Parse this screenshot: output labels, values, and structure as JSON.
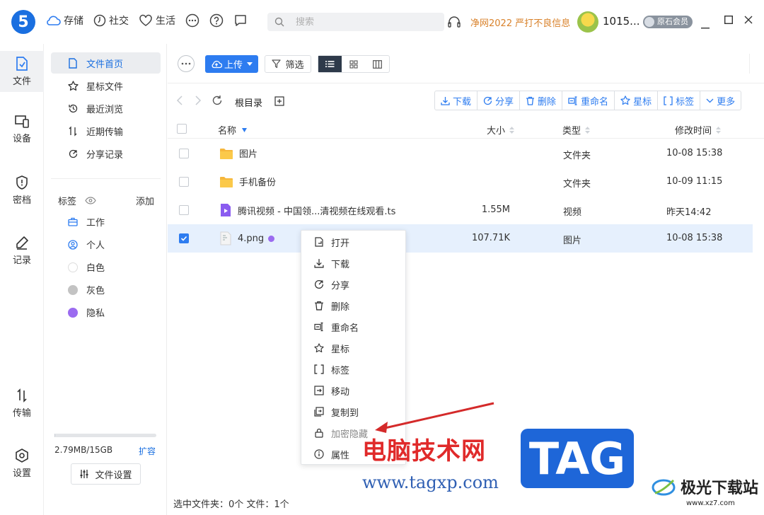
{
  "app": {
    "logo_text": "5",
    "nav": [
      {
        "label": "存储",
        "icon": "cloud-icon"
      },
      {
        "label": "社交",
        "icon": "clock-icon"
      },
      {
        "label": "生活",
        "icon": "heart-icon"
      }
    ],
    "search_placeholder": "搜索",
    "promo": "净网2022 严打不良信息",
    "username": "1015...",
    "member_badge": "原石会员"
  },
  "rail": [
    {
      "label": "文件",
      "icon": "file-icon",
      "active": true
    },
    {
      "label": "设备",
      "icon": "device-icon"
    },
    {
      "label": "密档",
      "icon": "shield-icon"
    },
    {
      "label": "记录",
      "icon": "pen-icon"
    },
    {
      "label": "传输",
      "icon": "transfer-icon"
    },
    {
      "label": "设置",
      "icon": "settings-icon"
    }
  ],
  "sidebar": {
    "items": [
      {
        "label": "文件首页",
        "icon": "document-icon",
        "active": true
      },
      {
        "label": "星标文件",
        "icon": "star-icon"
      },
      {
        "label": "最近浏览",
        "icon": "history-icon"
      },
      {
        "label": "近期传输",
        "icon": "transfer-icon"
      },
      {
        "label": "分享记录",
        "icon": "share-icon"
      }
    ],
    "tags_label": "标签",
    "tags_add": "添加",
    "tags": [
      {
        "label": "工作",
        "color": "#2d7cf0"
      },
      {
        "label": "个人",
        "color": "#2d7cf0"
      },
      {
        "label": "白色",
        "color": "#ffffff"
      },
      {
        "label": "灰色",
        "color": "#c3c3c3"
      },
      {
        "label": "隐私",
        "color": "#9b6bf0"
      }
    ],
    "storage_text": "2.79MB/15GB",
    "storage_used_fraction": 0.0002,
    "expand_label": "扩容",
    "file_settings_label": "文件设置"
  },
  "toolbar": {
    "upload_label": "上传",
    "filter_label": "筛选",
    "crumb": "根目录",
    "actions": [
      {
        "label": "下载",
        "icon": "download-icon"
      },
      {
        "label": "分享",
        "icon": "share-icon"
      },
      {
        "label": "删除",
        "icon": "trash-icon"
      },
      {
        "label": "重命名",
        "icon": "rename-icon"
      },
      {
        "label": "星标",
        "icon": "star-icon"
      },
      {
        "label": "标签",
        "icon": "tag-bracket-icon"
      },
      {
        "label": "更多",
        "icon": "chevron-down-icon"
      }
    ]
  },
  "table": {
    "headers": {
      "name": "名称",
      "size": "大小",
      "type": "类型",
      "mtime": "修改时间"
    },
    "rows": [
      {
        "name": "图片",
        "size": "",
        "type": "文件夹",
        "mtime": "10-08 15:38",
        "kind": "folder"
      },
      {
        "name": "手机备份",
        "size": "",
        "type": "文件夹",
        "mtime": "10-09 11:15",
        "kind": "folder"
      },
      {
        "name": "腾讯视频 - 中国领...清视频在线观看.ts",
        "size": "1.55M",
        "type": "视频",
        "mtime": "昨天14:42",
        "kind": "video"
      },
      {
        "name": "4.png",
        "size": "107.71K",
        "type": "图片",
        "mtime": "10-08 15:38",
        "kind": "image",
        "selected": true
      }
    ]
  },
  "status": "选中文件夹：0个 文件：1个",
  "context_menu": [
    {
      "label": "打开",
      "icon": "open-icon"
    },
    {
      "label": "下载",
      "icon": "download-icon"
    },
    {
      "label": "分享",
      "icon": "share-icon"
    },
    {
      "label": "删除",
      "icon": "trash-icon"
    },
    {
      "label": "重命名",
      "icon": "rename-icon"
    },
    {
      "label": "星标",
      "icon": "star-icon"
    },
    {
      "label": "标签",
      "icon": "tag-bracket-icon"
    },
    {
      "label": "移动",
      "icon": "move-icon"
    },
    {
      "label": "复制到",
      "icon": "copy-icon"
    },
    {
      "label": "加密隐藏",
      "icon": "lock-icon"
    },
    {
      "label": "属性",
      "icon": "info-icon"
    }
  ],
  "watermark": {
    "cn_text": "电脑技术网",
    "url": "www.tagxp.com",
    "tag": "TAG",
    "xz_name": "极光下载站",
    "xz_url": "www.xz7.com"
  },
  "colors": {
    "accent": "#2d7cf0",
    "promo": "#d9822b",
    "folder": "#f6b73c",
    "private": "#9b6bf0"
  }
}
